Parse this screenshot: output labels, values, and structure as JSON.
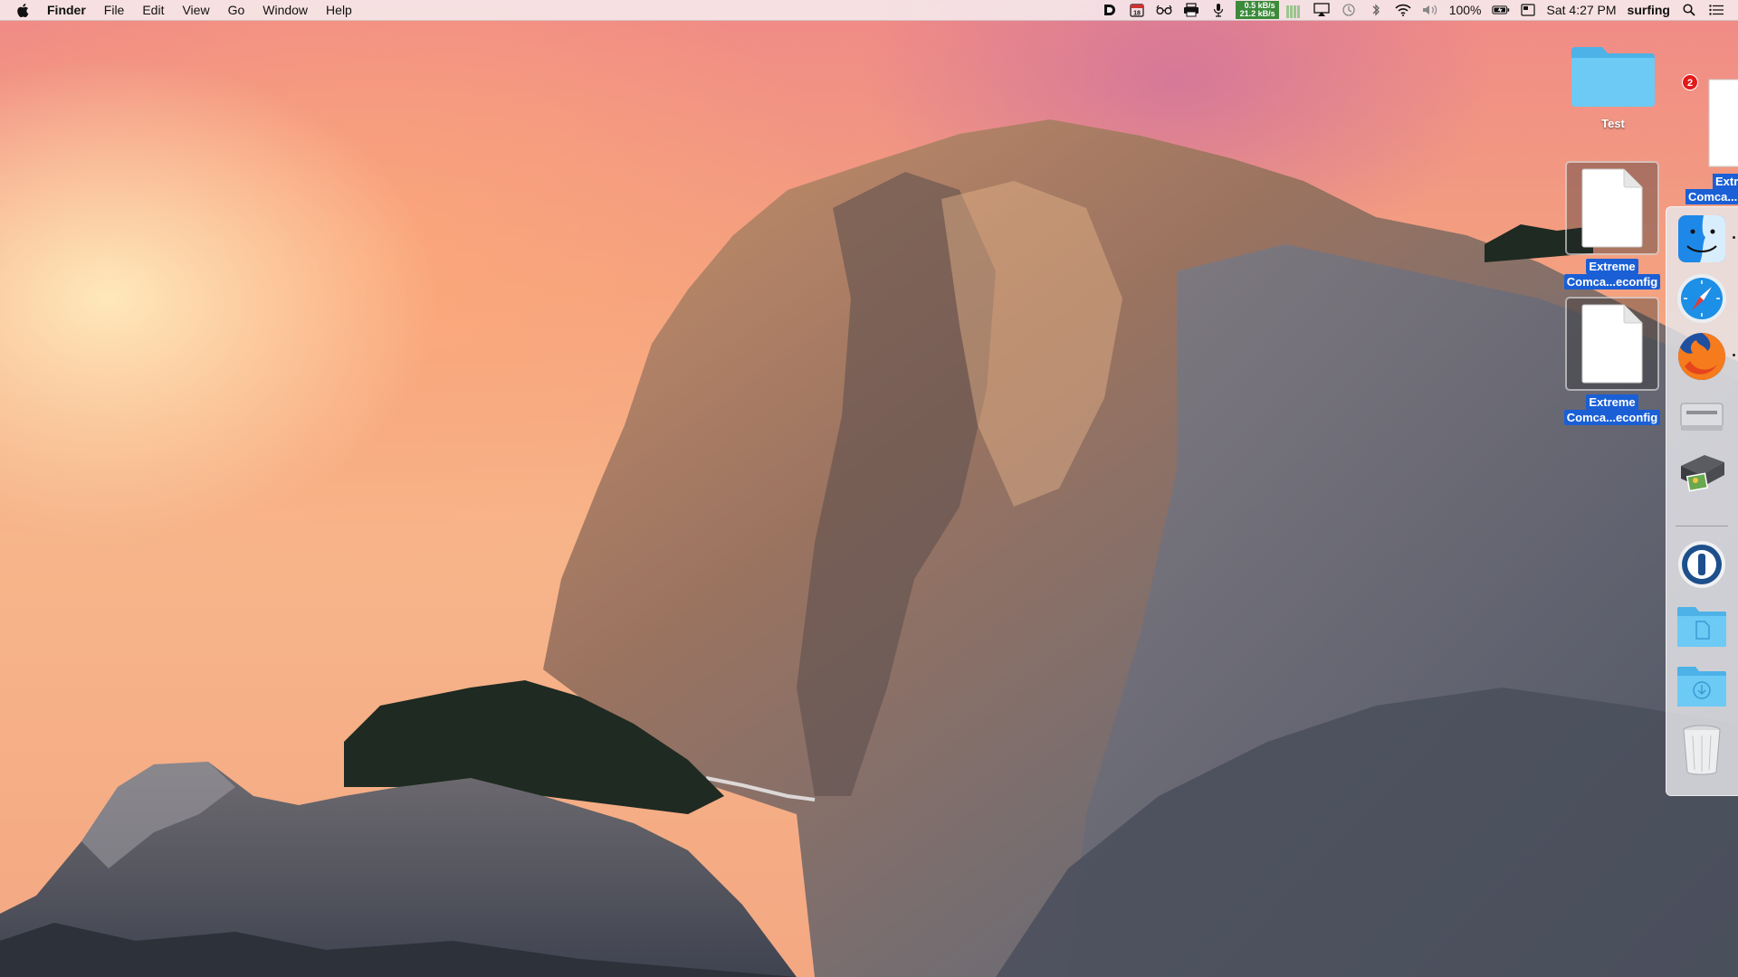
{
  "menubar": {
    "app_name": "Finder",
    "menus": [
      "File",
      "Edit",
      "View",
      "Go",
      "Window",
      "Help"
    ],
    "calendar_day": "18",
    "net_up": "0.5 kB/s",
    "net_down": "21.2 kB/s",
    "battery_percent": "100%",
    "clock": "Sat 4:27 PM",
    "user": "surfing"
  },
  "desktop": {
    "items": [
      {
        "label": "Test",
        "type": "folder"
      },
      {
        "label_line1": "Extreme",
        "label_line2": "Comca...econfig",
        "type": "file",
        "selected": true
      },
      {
        "label_line1": "Extreme",
        "label_line2": "Comca...econfig",
        "type": "file",
        "selected": true
      }
    ],
    "stack_preview": {
      "label_line1": "Extr",
      "label_line2": "Comca...",
      "badge": "2"
    }
  },
  "dock": {
    "items": [
      "finder-icon",
      "safari-icon",
      "firefox-icon",
      "printer-icon",
      "photo-printer-icon",
      "1password-icon",
      "documents-folder-icon",
      "downloads-folder-icon",
      "trash-icon"
    ]
  },
  "colors": {
    "selection": "#1a5fd6",
    "folder_blue": "#5fc2f2",
    "netstat_green": "#3c8a3a",
    "badge_red": "#e21a1a"
  }
}
